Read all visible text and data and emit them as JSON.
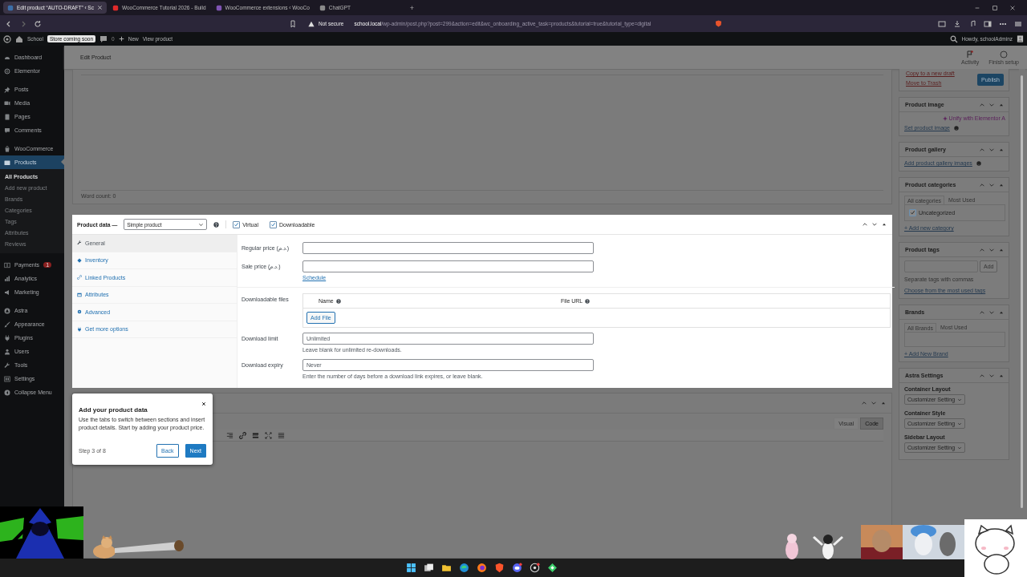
{
  "browser": {
    "tabs": [
      {
        "title": "Edit product “AUTO-DRAFT” ‹ Sc",
        "selected": true
      },
      {
        "title": "WooCommerce Tutorial 2026 - Build",
        "selected": false
      },
      {
        "title": "WooCommerce extensions ‹ WooCo",
        "selected": false
      },
      {
        "title": "ChatGPT",
        "selected": false
      }
    ],
    "new_tab": "+",
    "security": "Not secure",
    "url_host": "school.local",
    "url_path": "/wp-admin/post.php?post=299&action=edit&wc_onboarding_active_task=products&tutorial=true&tutorial_type=digital"
  },
  "admin_bar": {
    "site": "School",
    "badge": "Store coming soon",
    "comments": "0",
    "new": "New",
    "view": "View product",
    "greeting": "Howdy, schoolAdminz"
  },
  "sidebar": {
    "groups": [
      [
        {
          "label": "Dashboard",
          "selected": false
        },
        {
          "label": "Elementor",
          "selected": false
        }
      ],
      [
        {
          "label": "Posts",
          "selected": false
        },
        {
          "label": "Media",
          "selected": false
        },
        {
          "label": "Pages",
          "selected": false
        },
        {
          "label": "Comments",
          "selected": false
        }
      ],
      [
        {
          "label": "WooCommerce",
          "selected": false
        },
        {
          "label": "Products",
          "selected": true,
          "children": [
            {
              "label": "All Products",
              "selected": true
            },
            {
              "label": "Add new product",
              "selected": false
            },
            {
              "label": "Brands",
              "selected": false
            },
            {
              "label": "Categories",
              "selected": false
            },
            {
              "label": "Tags",
              "selected": false
            },
            {
              "label": "Attributes",
              "selected": false
            },
            {
              "label": "Reviews",
              "selected": false
            }
          ]
        }
      ],
      [
        {
          "label": "Payments",
          "selected": false,
          "badge": "1"
        },
        {
          "label": "Analytics",
          "selected": false
        },
        {
          "label": "Marketing",
          "selected": false
        }
      ],
      [
        {
          "label": "Astra",
          "selected": false
        },
        {
          "label": "Appearance",
          "selected": false
        },
        {
          "label": "Plugins",
          "selected": false
        },
        {
          "label": "Users",
          "selected": false
        },
        {
          "label": "Tools",
          "selected": false
        },
        {
          "label": "Settings",
          "selected": false
        },
        {
          "label": "Collapse Menu",
          "selected": false
        }
      ]
    ]
  },
  "page_header": {
    "title": "Edit Product",
    "actions": [
      {
        "label": "Activity"
      },
      {
        "label": "Finish setup"
      }
    ]
  },
  "editor": {
    "word_count": "Word count: 0"
  },
  "product_data": {
    "title": "Product data —",
    "type": "Simple product",
    "options": [
      {
        "label": "Virtual",
        "checked": true
      },
      {
        "label": "Downloadable",
        "checked": true
      }
    ],
    "tabs": [
      {
        "label": "General",
        "selected": true
      },
      {
        "label": "Inventory",
        "selected": false
      },
      {
        "label": "Linked Products",
        "selected": false
      },
      {
        "label": "Attributes",
        "selected": false
      },
      {
        "label": "Advanced",
        "selected": false
      },
      {
        "label": "Get more options",
        "selected": false
      }
    ],
    "fields": [
      {
        "kind": "input",
        "label": "Regular price (د.م.)"
      },
      {
        "kind": "input",
        "label": "Sale price (د.م.)",
        "link": "Schedule"
      },
      {
        "kind": "files",
        "label": "Downloadable files",
        "columns": [
          "Name",
          "File URL"
        ],
        "button": "Add File"
      },
      {
        "kind": "input",
        "label": "Download limit",
        "placeholder": "Unlimited",
        "hint": "Leave blank for unlimited re-downloads."
      },
      {
        "kind": "input",
        "label": "Download expiry",
        "placeholder": "Never",
        "hint": "Enter the number of days before a download link expires, or leave blank."
      }
    ]
  },
  "description": {
    "tabs": [
      {
        "label": "Visual",
        "selected": false
      },
      {
        "label": "Code",
        "selected": true
      }
    ]
  },
  "tour": {
    "title": "Add your product data",
    "text": "Use the tabs to switch between sections and insert product details. Start by adding your product price.",
    "step": "Step 3 of 8",
    "back": "Back",
    "next": "Next"
  },
  "publish": {
    "links": [
      "Copy to a new draft",
      "Move to Trash"
    ],
    "button": "Publish"
  },
  "boxes": [
    {
      "title": "Product image",
      "ai": "Unify with Elementor A",
      "link": "Set product image"
    },
    {
      "kind": "gallery",
      "title": "Product gallery",
      "link": "Add product gallery images"
    },
    {
      "kind": "terms",
      "title": "Product categories",
      "tabs": [
        {
          "label": "All categories",
          "selected": true
        },
        {
          "label": "Most Used",
          "selected": false
        }
      ],
      "terms": [
        {
          "label": "Uncategorized",
          "checked": true
        }
      ],
      "add": "+ Add new category"
    },
    {
      "kind": "tags",
      "title": "Product tags",
      "button": "Add",
      "hint": "Separate tags with commas",
      "link": "Choose from the most used tags"
    },
    {
      "kind": "terms",
      "title": "Brands",
      "tabs": [
        {
          "label": "All Brands",
          "selected": true
        },
        {
          "label": "Most Used",
          "selected": false
        }
      ],
      "add": "+ Add New Brand"
    },
    {
      "kind": "settings",
      "title": "Astra Settings",
      "selects": [
        {
          "label": "Container Layout",
          "value": "Customizer Setting"
        },
        {
          "label": "Container Style",
          "value": "Customizer Setting"
        },
        {
          "label": "Sidebar Layout",
          "value": "Customizer Setting"
        }
      ]
    }
  ]
}
